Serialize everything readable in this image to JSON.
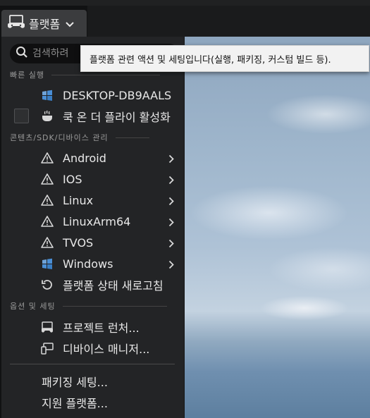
{
  "toolbar": {
    "platform_button_label": "플랫폼",
    "platform_icon": "gamepad-monitor-icon"
  },
  "search": {
    "placeholder": "검색하려"
  },
  "tooltip": {
    "text": "플랫폼 관련 액션 및 세팅입니다(실행, 패키징, 커스텀 빌드 등)."
  },
  "sections": {
    "quick_launch": "빠른 실행",
    "content_sdk": "콘텐츠/SDK/디바이스 관리",
    "options": "옵션 및 세팅"
  },
  "quick_launch": {
    "device": "DESKTOP-DB9AALS",
    "cook_on_the_fly": "쿡 온 더 플라이 활성화"
  },
  "platforms": [
    {
      "label": "Android",
      "icon": "warning-icon"
    },
    {
      "label": "IOS",
      "icon": "warning-icon"
    },
    {
      "label": "Linux",
      "icon": "warning-icon"
    },
    {
      "label": "LinuxArm64",
      "icon": "warning-icon"
    },
    {
      "label": "TVOS",
      "icon": "warning-icon"
    },
    {
      "label": "Windows",
      "icon": "windows-icon"
    }
  ],
  "refresh_label": "플랫폼 상태 새로고침",
  "options": {
    "project_launcher": "프로젝트 런처...",
    "device_manager": "디바이스 매니저..."
  },
  "footer": {
    "packaging_settings": "패키징 세팅...",
    "supported_platforms": "지원 플랫폼..."
  },
  "colors": {
    "menu_bg": "#232426",
    "accent_windows": "#4a8fd6",
    "tooltip_bg": "#f2f2f2"
  }
}
